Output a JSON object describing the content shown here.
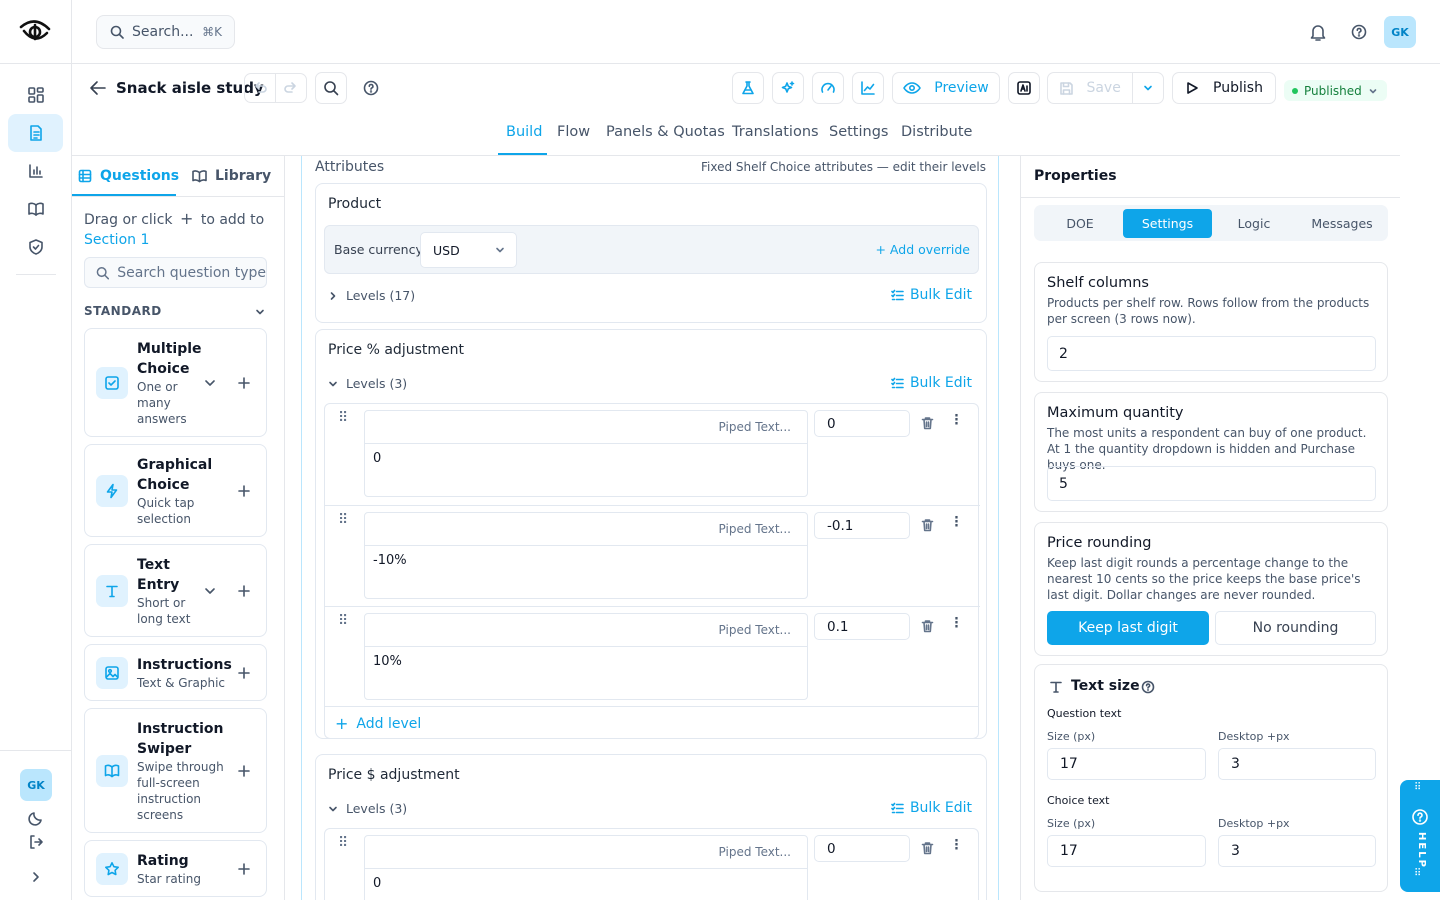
{
  "app": {
    "search_placeholder": "Search...",
    "search_shortcut": "⌘K",
    "user_initials": "GK"
  },
  "study": {
    "title": "Snack aisle study",
    "preview_label": "Preview",
    "save_label": "Save",
    "publish_label": "Publish",
    "status": "Published"
  },
  "tabs": [
    "Build",
    "Flow",
    "Panels & Quotas",
    "Translations",
    "Settings",
    "Distribute"
  ],
  "active_tab": "Build",
  "left_panel": {
    "tab_questions": "Questions",
    "tab_library": "Library",
    "hint_prefix": "Drag or click",
    "hint_suffix": "to add to",
    "hint_link": "Section 1",
    "search_placeholder": "Search question type",
    "section_label": "STANDARD",
    "items": [
      {
        "title": "Multiple Choice",
        "subtitle": "One or many answers",
        "icon": "checkbox-icon",
        "has_chevron": true
      },
      {
        "title": "Graphical Choice",
        "subtitle": "Quick tap selection",
        "icon": "lightning-icon",
        "has_chevron": false
      },
      {
        "title": "Text Entry",
        "subtitle": "Short or long text",
        "icon": "text-icon",
        "has_chevron": true
      },
      {
        "title": "Instructions",
        "subtitle": "Text & Graphic",
        "icon": "image-icon",
        "has_chevron": false
      },
      {
        "title": "Instruction Swiper",
        "subtitle": "Swipe through full-screen instruction screens",
        "icon": "book-icon",
        "has_chevron": false
      },
      {
        "title": "Rating",
        "subtitle": "Star rating",
        "icon": "star-icon",
        "has_chevron": false
      }
    ]
  },
  "center": {
    "heading": "Attributes",
    "note": "Fixed Shelf Choice attributes — edit their levels",
    "bulk_edit": "Bulk Edit",
    "piped_text": "Piped Text...",
    "add_level": "Add level",
    "product": {
      "title": "Product",
      "currency_label": "Base currency",
      "currency_value": "USD",
      "add_override": "Add override",
      "levels_label": "Levels (17)"
    },
    "price_pct": {
      "title": "Price % adjustment",
      "levels_label": "Levels (3)",
      "levels": [
        {
          "text": "0",
          "value": "0"
        },
        {
          "text": "-10%",
          "value": "-0.1"
        },
        {
          "text": "10%",
          "value": "0.1"
        }
      ]
    },
    "price_dollar": {
      "title": "Price $ adjustment",
      "levels_label": "Levels (3)",
      "levels": [
        {
          "text": "0",
          "value": "0"
        }
      ]
    }
  },
  "properties": {
    "title": "Properties",
    "tabs": [
      "DOE",
      "Settings",
      "Logic",
      "Messages"
    ],
    "active_tab": "Settings",
    "shelf_columns": {
      "title": "Shelf columns",
      "desc": "Products per shelf row. Rows follow from the products per screen (3 rows now).",
      "value": "2"
    },
    "max_quantity": {
      "title": "Maximum quantity",
      "desc": "The most units a respondent can buy of one product. At 1 the quantity dropdown is hidden and Purchase buys one.",
      "value": "5"
    },
    "price_rounding": {
      "title": "Price rounding",
      "desc": "Keep last digit rounds a percentage change to the nearest 10 cents so the price keeps the base price's last digit. Dollar changes are never rounded.",
      "option_active": "Keep last digit",
      "option_other": "No rounding"
    },
    "text_size": {
      "title": "Text size",
      "question_label": "Question text",
      "choice_label": "Choice text",
      "size_label": "Size (px)",
      "desktop_label": "Desktop +px",
      "question_size": "17",
      "question_desktop": "3",
      "choice_size": "17",
      "choice_desktop": "3"
    }
  },
  "help_label": "HELP",
  "colors": {
    "accent": "#0ea5e9",
    "accent_light": "#e0f2fe",
    "published_bg": "#ecfdf5",
    "published_text": "#15803d"
  }
}
